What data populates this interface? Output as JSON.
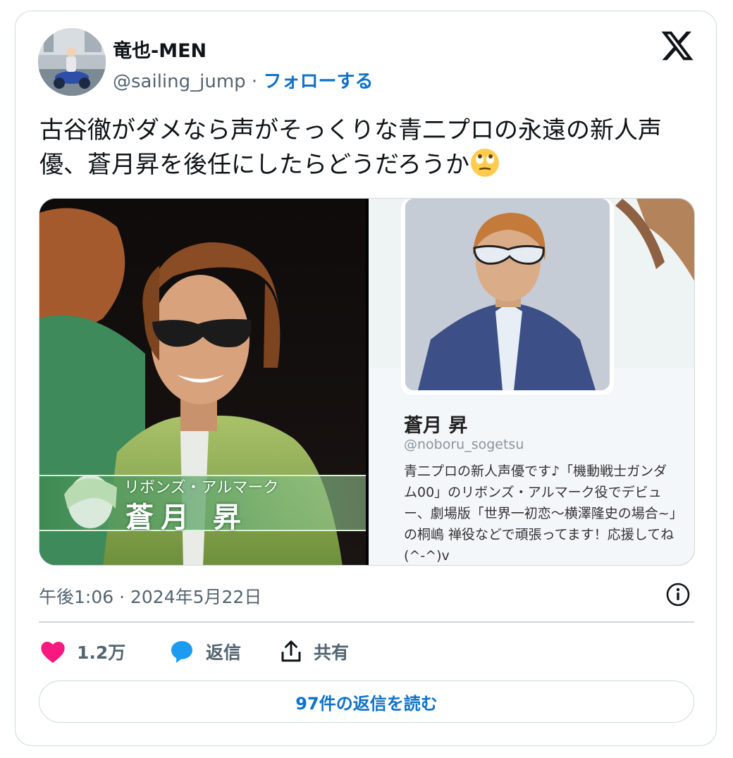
{
  "author": {
    "name": "竜也-MEN",
    "handle": "@sailing_jump",
    "separator": " · ",
    "follow_label": "フォローする"
  },
  "tweet": {
    "text": "古谷徹がダメなら声がそっくりな青二プロの永遠の新人声優、蒼月昇を後任にしたらどうだろうか",
    "emoji": "face-with-rolling-eyes"
  },
  "media": {
    "left_caption": {
      "role": "リボンズ・アルマーク",
      "name": "蒼月 昇"
    },
    "profile": {
      "name": "蒼月 昇",
      "handle": "@noboru_sogetsu",
      "bio": "青二プロの新人声優です♪「機動戦士ガンダム00」のリボンズ・アルマーク役でデビュー、劇場版「世界一初恋～横澤隆史の場合~」の桐嶋 禅役などで頑張ってます！応援してね(^-^)v"
    }
  },
  "timestamp": "午後1:06 · 2024年5月22日",
  "actions": {
    "like_count": "1.2万",
    "reply_label": "返信",
    "share_label": "共有"
  },
  "read_replies_label": "97件の返信を読む",
  "colors": {
    "like": "#f91880",
    "reply": "#1d9bf0",
    "link": "#0f72c8",
    "muted": "#536471",
    "border": "#cfd9de"
  }
}
